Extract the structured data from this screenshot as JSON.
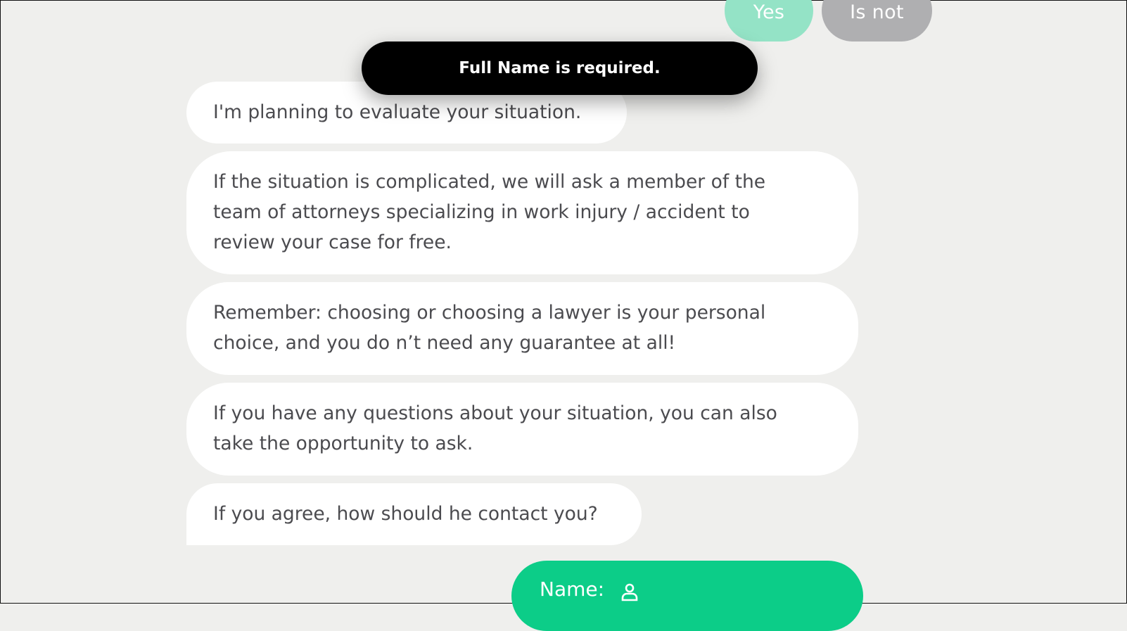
{
  "quick_replies": {
    "yes_label": "Yes",
    "no_label": "Is not"
  },
  "toast": {
    "message": "Full Name is required."
  },
  "messages": [
    {
      "lines": [
        "I'm planning to evaluate your situation."
      ]
    },
    {
      "lines": [
        "If the situation is complicated, we will ask a member of the",
        "team of attorneys specializing in work injury / accident to",
        "review your case for free."
      ]
    },
    {
      "lines": [
        "Remember: choosing or choosing a lawyer is your personal",
        "choice, and you do n’t need any guarantee at all!"
      ]
    },
    {
      "lines": [
        "If you have any questions about your situation, you can also",
        "take the opportunity to ask."
      ]
    },
    {
      "lines": [
        "If you agree, how should he contact you?"
      ]
    }
  ],
  "name_button": {
    "label": "Name:",
    "icon": "person-icon"
  },
  "colors": {
    "background": "#efefed",
    "accent_green": "#0ccd88",
    "yes_faded": "#94e3c6",
    "no_faded": "#afafb1",
    "toast_bg": "#000000",
    "bubble_text": "#4b4b4f"
  }
}
